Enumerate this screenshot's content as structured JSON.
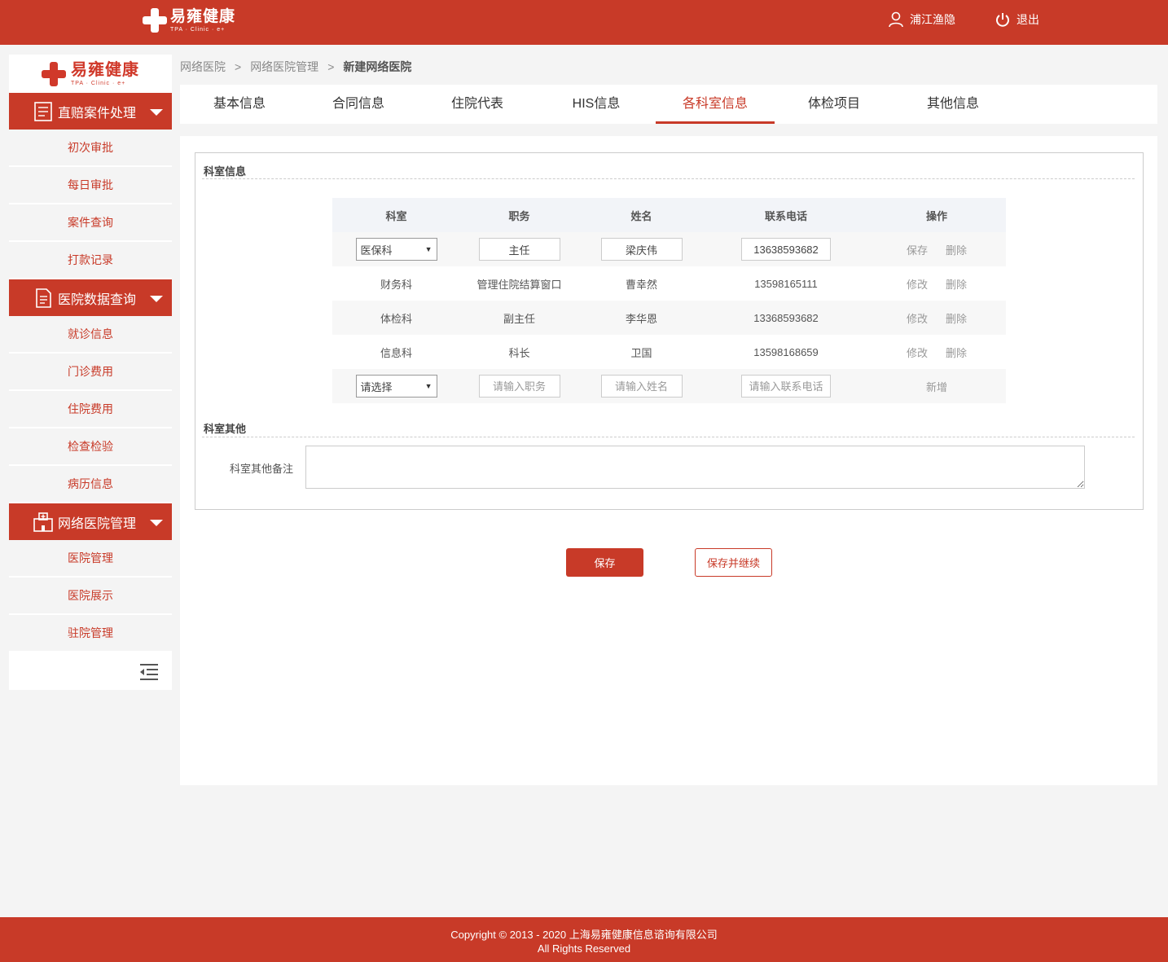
{
  "header": {
    "logo_name": "易雍健康",
    "logo_sub": "TPA · Clinic · e+",
    "user_name": "浦江渔隐",
    "logout_label": "退出",
    "accent_color": "#c83a28"
  },
  "sidebar": {
    "logo_name": "易雍健康",
    "logo_sub": "TPA · Clinic · e+",
    "groups": [
      {
        "label": "直赔案件处理",
        "icon": "claims-icon",
        "items": [
          "初次审批",
          "每日审批",
          "案件查询",
          "打款记录"
        ]
      },
      {
        "label": "医院数据查询",
        "icon": "document-icon",
        "items": [
          "就诊信息",
          "门诊费用",
          "住院费用",
          "检查检验",
          "病历信息"
        ]
      },
      {
        "label": "网络医院管理",
        "icon": "hospital-icon",
        "items": [
          "医院管理",
          "医院展示",
          "驻院管理"
        ]
      }
    ]
  },
  "breadcrumb": {
    "items": [
      "网络医院",
      "网络医院管理"
    ],
    "current": "新建网络医院",
    "separator": ">"
  },
  "tabs": {
    "items": [
      "基本信息",
      "合同信息",
      "住院代表",
      "HIS信息",
      "各科室信息",
      "体检项目",
      "其他信息"
    ],
    "active": "各科室信息"
  },
  "dept_section": {
    "title": "科室信息",
    "columns": [
      "科室",
      "职务",
      "姓名",
      "联系电话",
      "操作"
    ],
    "edit_row": {
      "dept": "医保科",
      "title": "主任",
      "name": "梁庆伟",
      "phone": "13638593682",
      "save": "保存",
      "delete": "删除"
    },
    "rows": [
      {
        "dept": "财务科",
        "title": "管理住院结算窗口",
        "name": "曹幸然",
        "phone": "13598165111",
        "edit": "修改",
        "delete": "删除"
      },
      {
        "dept": "体检科",
        "title": "副主任",
        "name": "李华恩",
        "phone": "13368593682",
        "edit": "修改",
        "delete": "删除"
      },
      {
        "dept": "信息科",
        "title": "科长",
        "name": "卫国",
        "phone": "13598168659",
        "edit": "修改",
        "delete": "删除"
      }
    ],
    "new_row": {
      "dept_placeholder": "请选择",
      "title_placeholder": "请输入职务",
      "name_placeholder": "请输入姓名",
      "phone_placeholder": "请输入联系电话",
      "add": "新增"
    }
  },
  "other_section": {
    "title": "科室其他",
    "remark_label": "科室其他备注",
    "remark_value": ""
  },
  "actions": {
    "save": "保存",
    "save_continue": "保存并继续"
  },
  "footer": {
    "line1": "Copyright © 2013 - 2020 上海易雍健康信息谘询有限公司",
    "line2": "All Rights Reserved"
  }
}
